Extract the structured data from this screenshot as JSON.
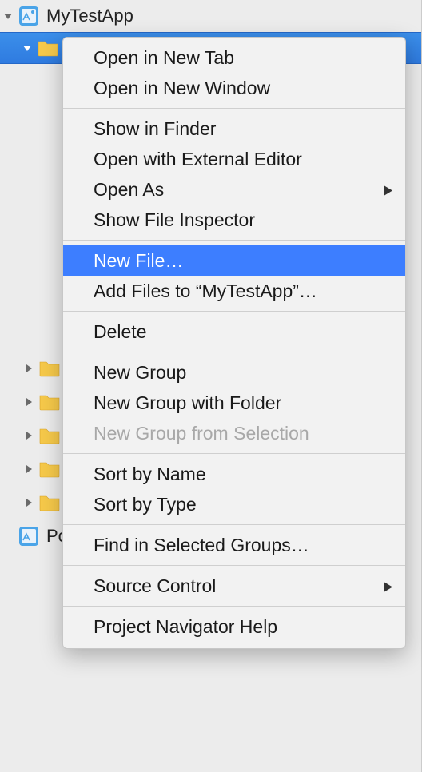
{
  "navigator": {
    "root_label": "MyTestApp",
    "selected_folder_label": "",
    "child_rows": [
      {
        "label": ""
      },
      {
        "label": ""
      },
      {
        "label": ""
      },
      {
        "label": ""
      },
      {
        "label": ""
      }
    ],
    "pods_label": "Po"
  },
  "menu": {
    "items": [
      {
        "label": "Open in New Tab",
        "type": "item"
      },
      {
        "label": "Open in New Window",
        "type": "item"
      },
      {
        "type": "sep"
      },
      {
        "label": "Show in Finder",
        "type": "item"
      },
      {
        "label": "Open with External Editor",
        "type": "item"
      },
      {
        "label": "Open As",
        "type": "item",
        "submenu": true
      },
      {
        "label": "Show File Inspector",
        "type": "item"
      },
      {
        "type": "sep"
      },
      {
        "label": "New File…",
        "type": "item",
        "highlighted": true
      },
      {
        "label": "Add Files to “MyTestApp”…",
        "type": "item"
      },
      {
        "type": "sep"
      },
      {
        "label": "Delete",
        "type": "item"
      },
      {
        "type": "sep"
      },
      {
        "label": "New Group",
        "type": "item"
      },
      {
        "label": "New Group with Folder",
        "type": "item"
      },
      {
        "label": "New Group from Selection",
        "type": "item",
        "disabled": true
      },
      {
        "type": "sep"
      },
      {
        "label": "Sort by Name",
        "type": "item"
      },
      {
        "label": "Sort by Type",
        "type": "item"
      },
      {
        "type": "sep"
      },
      {
        "label": "Find in Selected Groups…",
        "type": "item"
      },
      {
        "type": "sep"
      },
      {
        "label": "Source Control",
        "type": "item",
        "submenu": true
      },
      {
        "type": "sep"
      },
      {
        "label": "Project Navigator Help",
        "type": "item"
      }
    ]
  }
}
